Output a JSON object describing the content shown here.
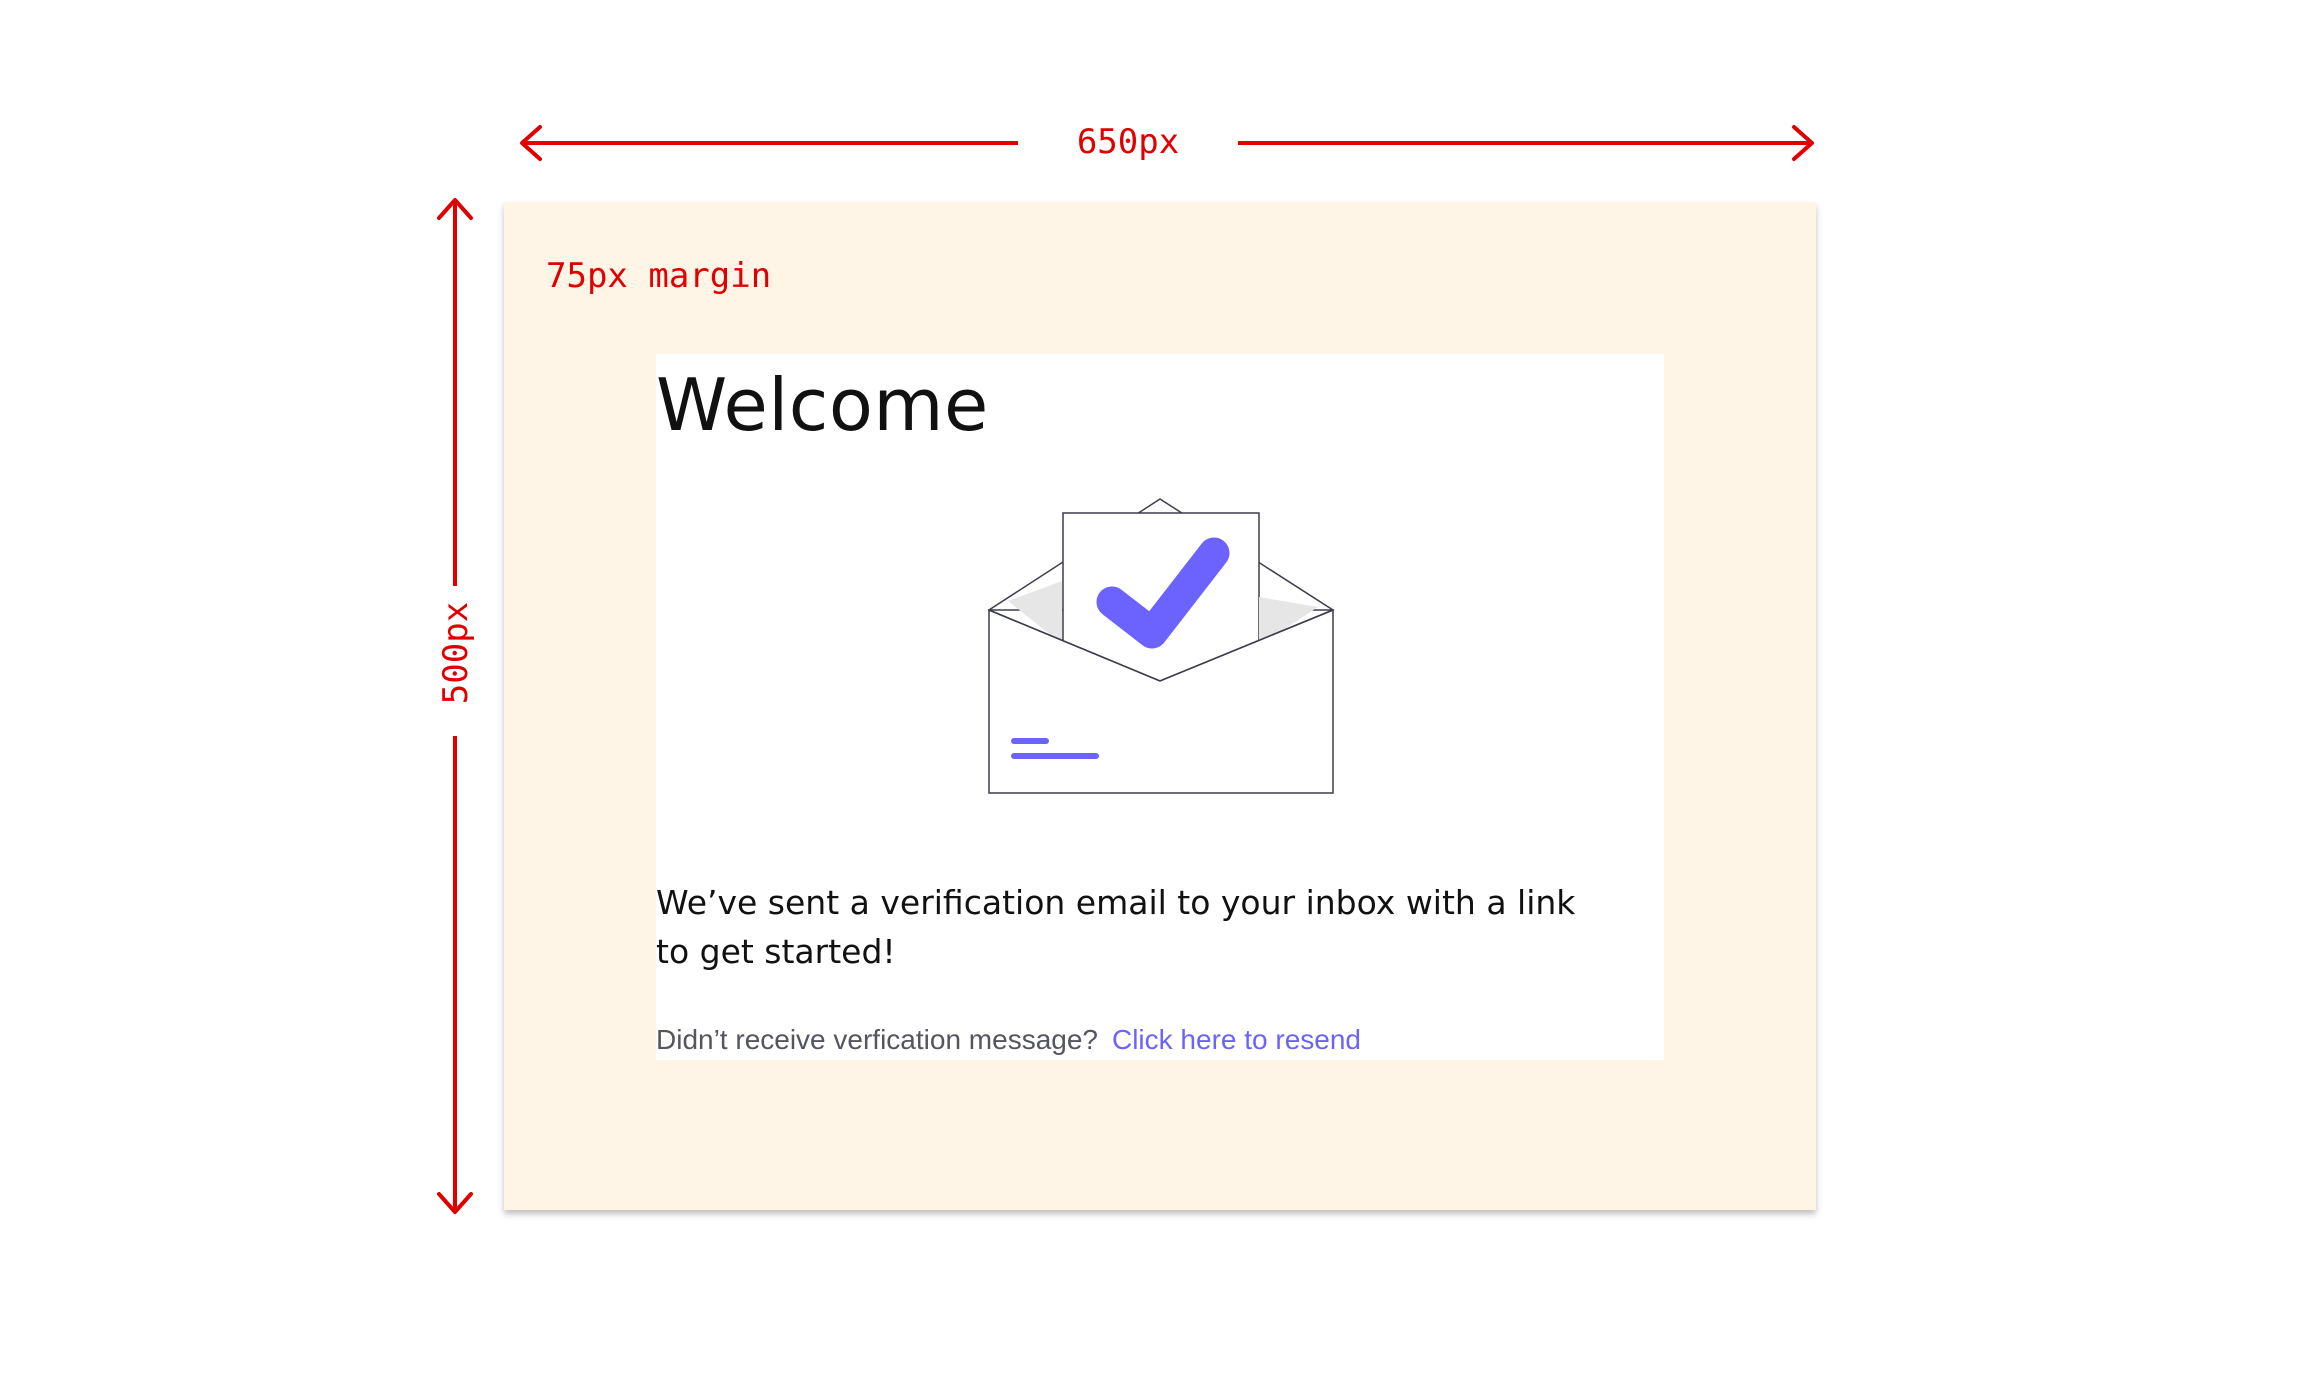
{
  "annotations": {
    "width_label": "650px",
    "height_label": "500px",
    "margin_label": "75px margin"
  },
  "card": {
    "title": "Welcome",
    "illustration_icon": "envelope-checkmark-icon",
    "body": "We’ve sent a verification email to your inbox with a link to get started!",
    "resend_prompt": "Didn’t receive verfication message?",
    "resend_link": "Click here to resend"
  },
  "colors": {
    "annotation": "#e00000",
    "frame_background": "#fff5e6",
    "accent": "#6c63ff",
    "text": "#111111",
    "muted_text": "#55555f"
  }
}
